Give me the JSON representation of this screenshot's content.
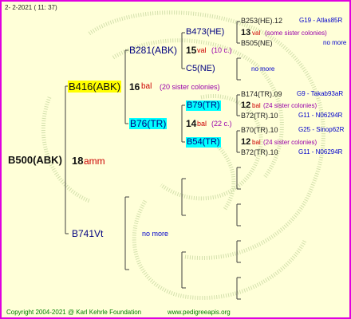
{
  "header": {
    "left": "2-   2-2021  (  11:  37)"
  },
  "root": {
    "name": "B500(ABK)",
    "num": "18",
    "line": "amm"
  },
  "g1": {
    "top": {
      "name": "B416(ABK)",
      "num": "16",
      "line": "bal",
      "note": "(20 sister colonies)"
    },
    "bottom": {
      "name": "B741Vt",
      "no_more": "no more"
    }
  },
  "g2": {
    "a": {
      "name": "B281(ABK)"
    },
    "b": {
      "name": "B76(TR)"
    }
  },
  "g3": {
    "a": {
      "name": "B473(HE)",
      "num": "15",
      "line": "val",
      "note": "(10 c.)"
    },
    "b": {
      "name": "C5(NE)",
      "no_more": "no more"
    },
    "c": {
      "name": "B79(TR)",
      "num": "14",
      "line": "bal",
      "note": "(22 c.)"
    },
    "d": {
      "name": "B54(TR)"
    }
  },
  "g4": {
    "a1": {
      "name": "B253(HE).12",
      "ref": "G19 - Atlas85R"
    },
    "a2": {
      "num": "13",
      "line": "val",
      "note": "(some sister colonies)"
    },
    "a3": {
      "name": "B505(NE)",
      "ref": "no more"
    },
    "b1": {
      "no_more": "no more"
    },
    "c1": {
      "name": "B174(TR).09",
      "ref": "G9 - Takab93aR"
    },
    "c2": {
      "num": "12",
      "line": "bal",
      "note": "(24 sister colonies)"
    },
    "c3": {
      "name": "B72(TR).10",
      "ref": "G11 - N06294R"
    },
    "d1": {
      "name": "B70(TR).10",
      "ref": "G25 - Sinop62R"
    },
    "d2": {
      "num": "12",
      "line": "bal",
      "note": "(24 sister colonies)"
    },
    "d3": {
      "name": "B72(TR).10",
      "ref": "G11 - N06294R"
    }
  },
  "footer": {
    "copyright": "Copyright 2004-2021 @ Karl Kehrle Foundation",
    "url": "www.pedigreeapis.org"
  },
  "colors": {
    "border": "#e000e0",
    "background": "#ffffd8",
    "highlight_yellow": "#ffff00",
    "highlight_cyan": "#00ffff",
    "footer_green": "#008000"
  }
}
